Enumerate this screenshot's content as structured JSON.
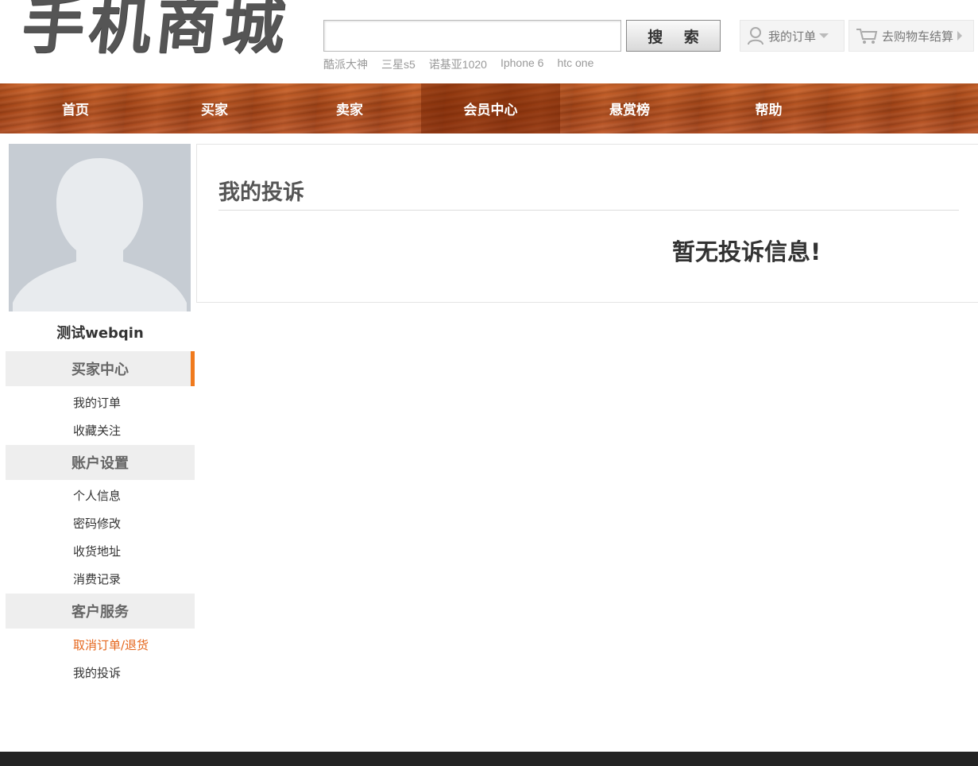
{
  "header": {
    "logo_text": "手机商城",
    "search": {
      "value": "",
      "placeholder": "",
      "button_label": "搜 索"
    },
    "hot_words": [
      "酷派大神",
      "三星s5",
      "诺基亚1020",
      "Iphone 6",
      "htc one"
    ],
    "my_orders_label": "我的订单",
    "cart_label": "去购物车结算"
  },
  "nav": {
    "items": [
      {
        "label": "首页"
      },
      {
        "label": "买家"
      },
      {
        "label": "卖家"
      },
      {
        "label": "会员中心"
      },
      {
        "label": "悬赏榜"
      },
      {
        "label": "帮助"
      }
    ]
  },
  "sidebar": {
    "username": "测试webqin",
    "sections": [
      {
        "title": "买家中心",
        "links": [
          "我的订单",
          "收藏关注"
        ]
      },
      {
        "title": "账户设置",
        "links": [
          "个人信息",
          "密码修改",
          "收货地址",
          "消费记录"
        ]
      },
      {
        "title": "客户服务",
        "links": [
          "取消订单/退货",
          "我的投诉"
        ]
      }
    ]
  },
  "main": {
    "title": "我的投诉",
    "empty_message": "暂无投诉信息!"
  },
  "colors": {
    "accent": "#f07a1d",
    "nav_wood": "#b9542a",
    "footer": "#232323"
  }
}
